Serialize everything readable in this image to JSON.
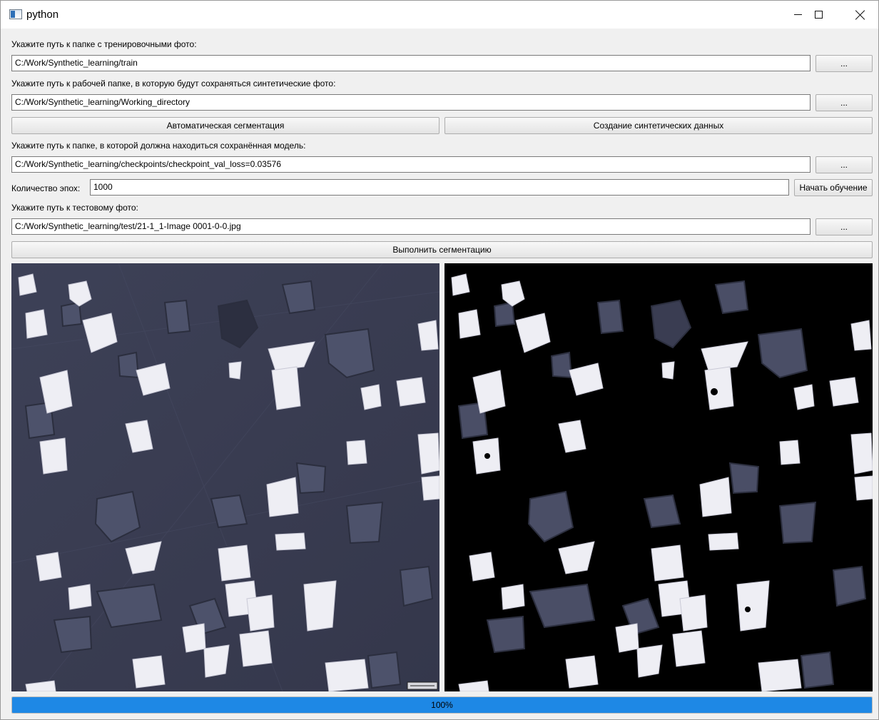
{
  "window": {
    "title": "python"
  },
  "train": {
    "label": "Укажите путь к папке с тренировочными фото:",
    "value": "C:/Work/Synthetic_learning/train",
    "browse_label": "..."
  },
  "workdir": {
    "label": "Укажите путь к рабочей папке, в которую будут сохраняться синтетические фото:",
    "value": "C:/Work/Synthetic_learning/Working_directory",
    "browse_label": "..."
  },
  "actions": {
    "auto_segmentation_label": "Автоматическая сегментация",
    "create_synthetic_label": "Создание синтетических данных"
  },
  "model": {
    "label": "Укажите путь к папке, в которой должна находиться сохранённая модель:",
    "value": "C:/Work/Synthetic_learning/checkpoints/checkpoint_val_loss=0.03576",
    "browse_label": "..."
  },
  "epochs": {
    "label": "Количество эпох:",
    "value": "1000",
    "start_training_label": "Начать обучение"
  },
  "test": {
    "label": "Укажите путь к тестовому фото:",
    "value": "C:/Work/Synthetic_learning/test/21-1_1-Image 0001-0-0.jpg",
    "browse_label": "..."
  },
  "segment_button_label": "Выполнить сегментацию",
  "images": {
    "scale_bar_text": "100 мкм"
  },
  "progress": {
    "value": 1.0,
    "text": "100%"
  },
  "colors": {
    "accent": "#1e88e5",
    "window_bg": "#f0f0f0",
    "micro_bg": "#3a3e52",
    "particle_bright": "#f2f2f7",
    "particle_dark": "#4a4f66",
    "mask_bg": "#000000"
  }
}
